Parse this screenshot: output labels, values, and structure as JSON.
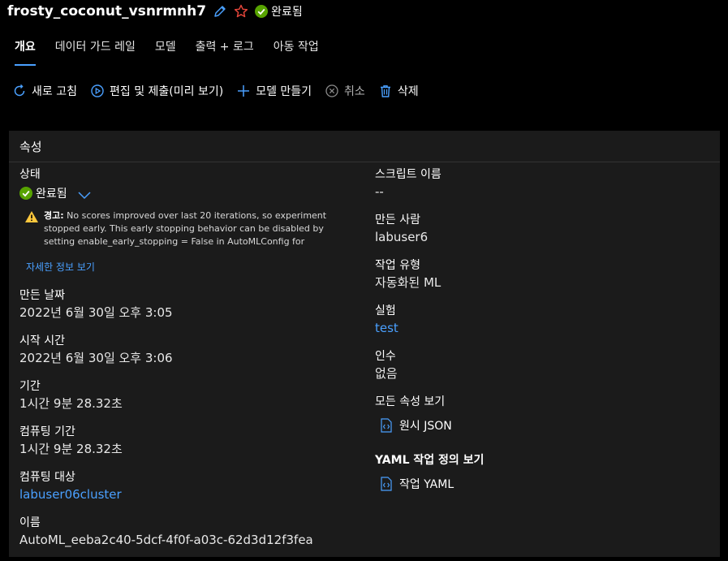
{
  "header": {
    "title": "frosty_coconut_vsnrmnh7",
    "status": "완료됨"
  },
  "tabs": [
    {
      "label": "개요",
      "active": true
    },
    {
      "label": "데이터 가드 레일"
    },
    {
      "label": "모델"
    },
    {
      "label": "출력 + 로그"
    },
    {
      "label": "아동 작업"
    }
  ],
  "toolbar": {
    "refresh": "새로 고침",
    "edit_submit": "편집 및 제출(미리 보기)",
    "create_model": "모델 만들기",
    "cancel": "취소",
    "delete": "삭제"
  },
  "panel": {
    "title": "속성",
    "left": {
      "status_label": "상태",
      "status_value": "완료됨",
      "warning_prefix": "경고:",
      "warning_text": "No scores improved over last 20 iterations, so experiment stopped early. This early stopping behavior can be disabled by setting enable_early_stopping = False in AutoMLConfig for notebook/python",
      "details_link": "자세한 정보 보기",
      "created_label": "만든 날짜",
      "created_value": "2022년 6월 30일 오후 3:05",
      "start_label": "시작 시간",
      "start_value": "2022년 6월 30일 오후 3:06",
      "duration_label": "기간",
      "duration_value": "1시간 9분 28.32초",
      "compute_duration_label": "컴퓨팅 기간",
      "compute_duration_value": "1시간 9분 28.32초",
      "compute_target_label": "컴퓨팅 대상",
      "compute_target_value": "labuser06cluster",
      "name_label": "이름",
      "name_value": "AutoML_eeba2c40-5dcf-4f0f-a03c-62d3d12f3fea"
    },
    "right": {
      "script_label": "스크립트 이름",
      "script_value": "--",
      "created_by_label": "만든 사람",
      "created_by_value": "labuser6",
      "job_type_label": "작업 유형",
      "job_type_value": "자동화된 ML",
      "experiment_label": "실험",
      "experiment_value": "test",
      "args_label": "인수",
      "args_value": "없음",
      "all_props_label": "모든 속성 보기",
      "raw_json": "원시 JSON",
      "yaml_label": "YAML 작업 정의 보기",
      "yaml_link": "작업 YAML"
    }
  },
  "colors": {
    "accent": "#4aa0ff",
    "success": "#57a300",
    "warning": "#ffc83d",
    "star": "#e8473b",
    "panel_bg": "#1b1b1b"
  }
}
